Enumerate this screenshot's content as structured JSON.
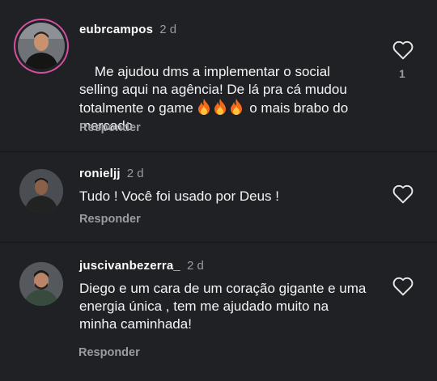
{
  "comments": [
    {
      "username": "eubrcampos",
      "time": "2 d",
      "text_part1": "Me ajudou dms a implementar o social selling aqui na agência! De lá pra cá mudou totalmente o game ",
      "text_part2": " o mais brabo do mercado",
      "fire_count": 3,
      "reply_label": "Responder",
      "like_count": "1",
      "avatar_icon": "person-avatar-icon",
      "story_ring_color": "#d64fa0"
    },
    {
      "username": "ronieljj",
      "time": "2 d",
      "text": "Tudo ! Você foi usado por Deus !",
      "reply_label": "Responder",
      "avatar_icon": "person-avatar-icon"
    },
    {
      "username": "juscivanbezerra_",
      "time": "2 d",
      "text": "Diego e um cara de um coração gigante e uma energia única , tem me ajudado muito na minha caminhada!",
      "reply_label": "Responder",
      "avatar_icon": "person-avatar-icon"
    }
  ],
  "colors": {
    "background": "#1f2125",
    "divider": "#141518",
    "secondary_text": "#9a9ca1",
    "primary_text": "#f4f4f4"
  }
}
